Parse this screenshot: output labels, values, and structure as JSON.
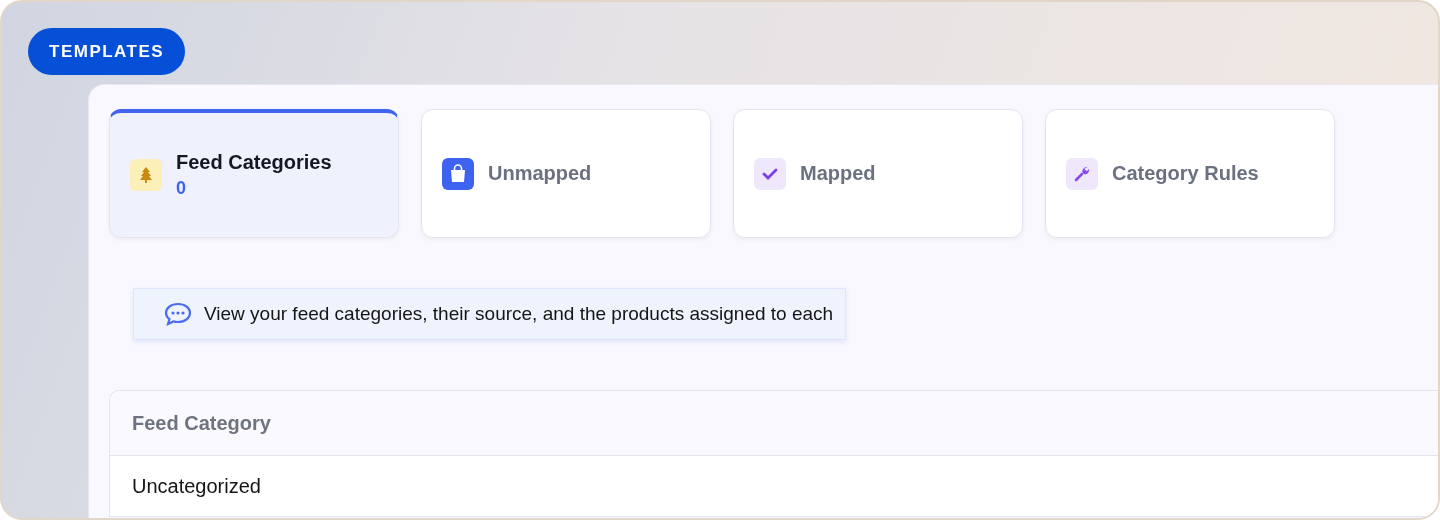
{
  "badge": "TEMPLATES",
  "tabs": [
    {
      "kind": "tree",
      "label": "Feed Categories",
      "count": "0",
      "selected": true
    },
    {
      "kind": "bag",
      "label": "Unmapped",
      "selected": false
    },
    {
      "kind": "check",
      "label": "Mapped",
      "selected": false
    },
    {
      "kind": "wrench",
      "label": "Category Rules",
      "selected": false
    }
  ],
  "note": "View your feed categories, their source, and the products assigned to each",
  "table": {
    "columns": [
      "Feed Category"
    ],
    "rows": [
      [
        "Uncategorized"
      ]
    ]
  }
}
